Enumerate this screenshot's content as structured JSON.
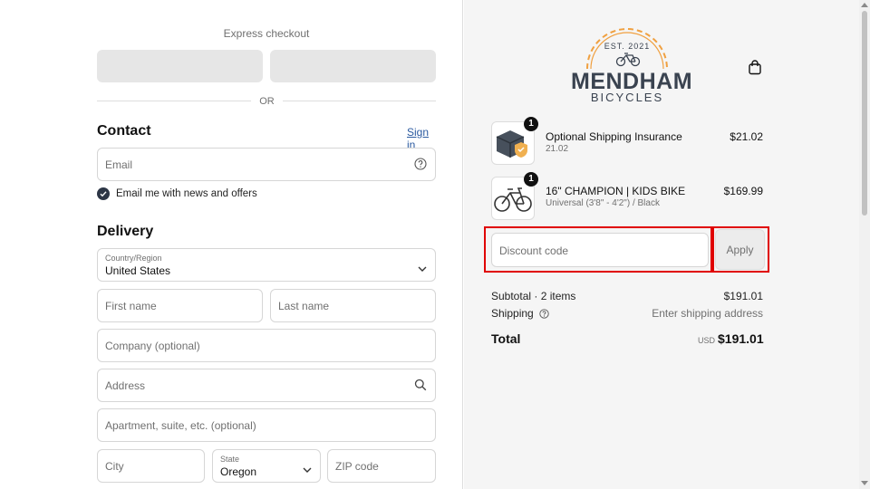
{
  "express": {
    "title": "Express checkout",
    "or": "OR"
  },
  "contact": {
    "title": "Contact",
    "sign_in": "Sign in",
    "email_placeholder": "Email",
    "newsletter_label": "Email me with news and offers"
  },
  "delivery": {
    "title": "Delivery",
    "country_label": "Country/Region",
    "country_value": "United States",
    "first_name": "First name",
    "last_name": "Last name",
    "company": "Company (optional)",
    "address": "Address",
    "apartment": "Apartment, suite, etc. (optional)",
    "city": "City",
    "state_label": "State",
    "state_value": "Oregon",
    "zip": "ZIP code"
  },
  "brand": {
    "est": "EST. 2021",
    "name": "MENDHAM",
    "sub": "BICYCLES"
  },
  "cart": {
    "items": [
      {
        "qty": "1",
        "name": "Optional Shipping Insurance",
        "sub": "21.02",
        "price": "$21.02"
      },
      {
        "qty": "1",
        "name": "16\" CHAMPION | KIDS BIKE",
        "sub": "Universal (3'8\" - 4'2\") / Black",
        "price": "$169.99"
      }
    ],
    "discount_placeholder": "Discount code",
    "apply_label": "Apply"
  },
  "summary": {
    "subtotal_label": "Subtotal · 2 items",
    "subtotal_value": "$191.01",
    "shipping_label": "Shipping",
    "shipping_value": "Enter shipping address",
    "total_label": "Total",
    "total_currency": "USD",
    "total_value": "$191.01"
  },
  "colors": {
    "accent": "#2d3646",
    "link": "#2b5aa0",
    "highlight": "#e00000",
    "logo_orange": "#f0a040"
  }
}
